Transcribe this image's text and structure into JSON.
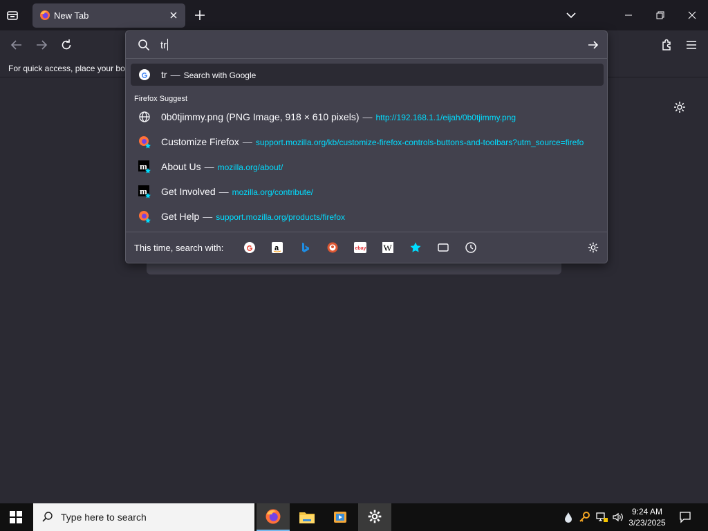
{
  "window": {
    "tab_title": "New Tab"
  },
  "bookmarks": {
    "hint": "For quick access, place your boo"
  },
  "urlbar": {
    "typed_text": "tr",
    "top_result": {
      "query": "tr",
      "action": "Search with Google"
    },
    "group_label": "Firefox Suggest",
    "suggestions": [
      {
        "title": "0b0tjimmy.png (PNG Image, 918 × 610 pixels)",
        "url": "http://192.168.1.1/eijah/0b0tjimmy.png",
        "icon": "globe-icon"
      },
      {
        "title": "Customize Firefox",
        "url": "support.mozilla.org/kb/customize-firefox-controls-buttons-and-toolbars?utm_source=firefo",
        "icon": "firefox-bookmark-icon"
      },
      {
        "title": "About Us",
        "url": "mozilla.org/about/",
        "icon": "mozilla-bookmark-icon"
      },
      {
        "title": "Get Involved",
        "url": "mozilla.org/contribute/",
        "icon": "mozilla-bookmark-icon"
      },
      {
        "title": "Get Help",
        "url": "support.mozilla.org/products/firefox",
        "icon": "firefox-bookmark-icon"
      }
    ],
    "separator": "—",
    "footer_label": "This time, search with:",
    "engines": [
      "google-icon",
      "amazon-icon",
      "bing-icon",
      "duckduckgo-icon",
      "ebay-icon",
      "wikipedia-icon",
      "bookmarks-star-icon",
      "tabs-icon",
      "history-icon"
    ]
  },
  "taskbar": {
    "search_placeholder": "Type here to search",
    "time": "9:24 AM",
    "date": "3/23/2025"
  },
  "colors": {
    "accent": "#00ddff",
    "panel": "#42414d",
    "background": "#2b2a33",
    "tabstrip": "#1c1b22"
  }
}
